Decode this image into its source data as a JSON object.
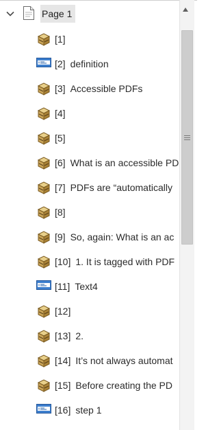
{
  "page_node": {
    "label": "Page 1",
    "expanded": true
  },
  "items": [
    {
      "num": "[1]",
      "text": "",
      "icon": "container-box-icon"
    },
    {
      "num": "[2]",
      "text": "definition",
      "icon": "text-field-icon"
    },
    {
      "num": "[3]",
      "text": "Accessible PDFs",
      "icon": "container-box-icon"
    },
    {
      "num": "[4]",
      "text": "",
      "icon": "container-box-icon"
    },
    {
      "num": "[5]",
      "text": "",
      "icon": "container-box-icon"
    },
    {
      "num": "[6]",
      "text": "What is an accessible PDF",
      "icon": "container-box-icon"
    },
    {
      "num": "[7]",
      "text": "PDFs are “automatically",
      "icon": "container-box-icon"
    },
    {
      "num": "[8]",
      "text": "",
      "icon": "container-box-icon"
    },
    {
      "num": "[9]",
      "text": "So, again: What is an ac",
      "icon": "container-box-icon"
    },
    {
      "num": "[10]",
      "text": "1. It is tagged with PDF",
      "icon": "container-box-icon"
    },
    {
      "num": "[11]",
      "text": "Text4",
      "icon": "text-field-icon"
    },
    {
      "num": "[12]",
      "text": "",
      "icon": "container-box-icon"
    },
    {
      "num": "[13]",
      "text": "2.",
      "icon": "container-box-icon"
    },
    {
      "num": "[14]",
      "text": "It’s not always automat",
      "icon": "container-box-icon"
    },
    {
      "num": "[15]",
      "text": "Before creating the PD",
      "icon": "container-box-icon"
    },
    {
      "num": "[16]",
      "text": "step 1",
      "icon": "text-field-icon"
    }
  ]
}
